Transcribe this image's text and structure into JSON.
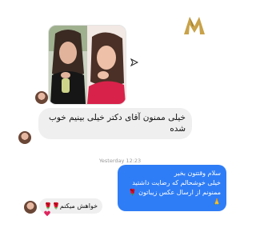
{
  "brand": {
    "logo_icon": "gold-m-logo-icon"
  },
  "thread": {
    "shared_post": {
      "image": "two-photo-collage",
      "share_icon": "share-arrow-icon"
    },
    "incoming_message_1": "خیلی ممنون آقای دکتر خیلی بینیم خوب شده",
    "timestamp": "Yesterday 12:23",
    "outgoing_message": {
      "line1": "سلام وقتتون بخیر",
      "line2": "خیلی خوشحالم که رضایت داشتید",
      "line3": "ممنونم از ارسال عکس زیباتون 🌹🙏"
    },
    "incoming_message_2": "خواهش میکنم🌹🌹",
    "reaction": "heart-icon"
  },
  "colors": {
    "accent": "#2f7df6",
    "incoming_bg": "#efefef",
    "logo_gold": "#c8a24a"
  }
}
